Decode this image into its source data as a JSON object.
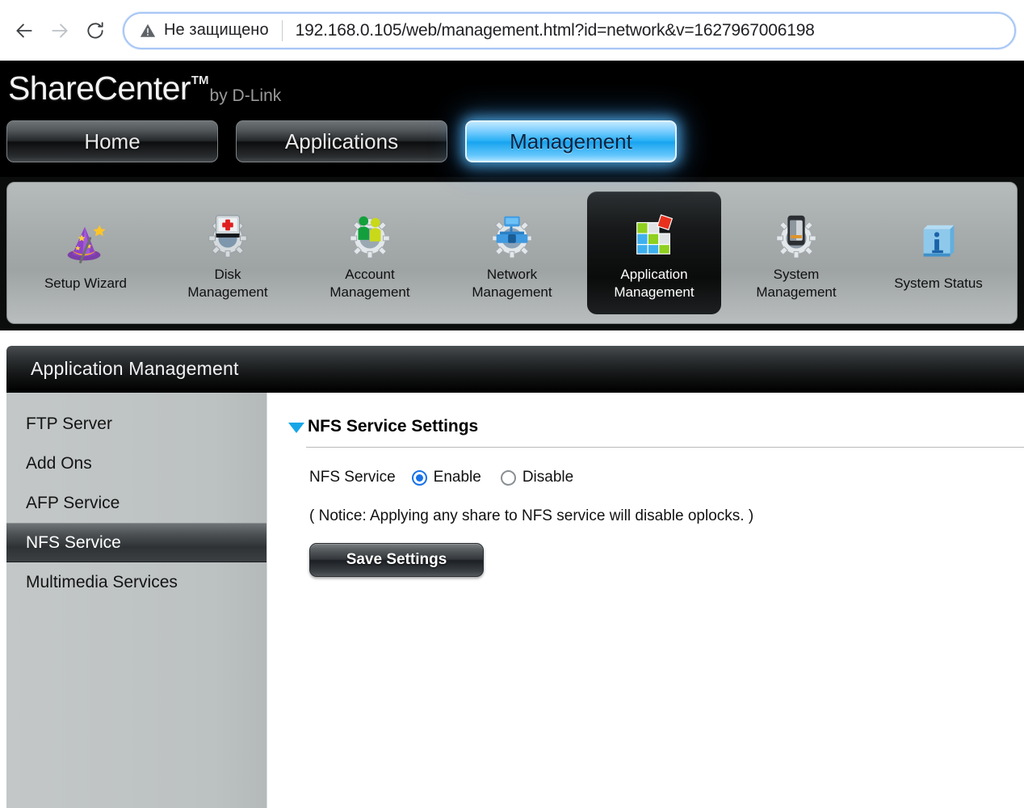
{
  "browser": {
    "back_icon": "back-arrow-icon",
    "forward_icon": "forward-arrow-icon",
    "reload_icon": "reload-icon",
    "security_icon": "not-secure-warning-icon",
    "security_label": "Не защищено",
    "url": "192.168.0.105/web/management.html?id=network&v=1627967006198"
  },
  "header": {
    "logo_main": "ShareCenter",
    "logo_tm": "TM",
    "logo_by": "by D-Link",
    "tabs": [
      {
        "label": "Home",
        "active": false
      },
      {
        "label": "Applications",
        "active": false
      },
      {
        "label": "Management",
        "active": true
      }
    ]
  },
  "toolbar": {
    "items": [
      {
        "label": "Setup Wizard",
        "icon": "wizard-hat-icon",
        "selected": false
      },
      {
        "label": "Disk\nManagement",
        "line1": "Disk",
        "line2": "Management",
        "icon": "disk-gear-icon",
        "selected": false
      },
      {
        "label": "Account\nManagement",
        "line1": "Account",
        "line2": "Management",
        "icon": "account-gear-icon",
        "selected": false
      },
      {
        "label": "Network\nManagement",
        "line1": "Network",
        "line2": "Management",
        "icon": "network-gear-icon",
        "selected": false
      },
      {
        "label": "Application\nManagement",
        "line1": "Application",
        "line2": "Management",
        "icon": "application-blocks-icon",
        "selected": true
      },
      {
        "label": "System\nManagement",
        "line1": "System",
        "line2": "Management",
        "icon": "system-gear-icon",
        "selected": false
      },
      {
        "label": "System Status",
        "line1": "System Status",
        "line2": "",
        "icon": "info-cube-icon",
        "selected": false
      }
    ]
  },
  "panel": {
    "title": "Application Management",
    "sidebar": [
      {
        "label": "FTP Server",
        "selected": false
      },
      {
        "label": "Add Ons",
        "selected": false
      },
      {
        "label": "AFP Service",
        "selected": false
      },
      {
        "label": "NFS Service",
        "selected": true
      },
      {
        "label": "Multimedia Services",
        "selected": false
      }
    ],
    "section": {
      "toggle_icon": "collapse-triangle-icon",
      "title": "NFS Service Settings",
      "field_label": "NFS Service",
      "options": [
        {
          "label": "Enable",
          "selected": true
        },
        {
          "label": "Disable",
          "selected": false
        }
      ],
      "notice": "( Notice: Applying any share to NFS service will disable oplocks. )",
      "save_label": "Save Settings"
    }
  },
  "colors": {
    "accent_blue": "#16a6e8",
    "radio_blue": "#1a73e8",
    "active_tab_blue": "#2bb0f5",
    "panel_gray": "#bcc1c1"
  }
}
